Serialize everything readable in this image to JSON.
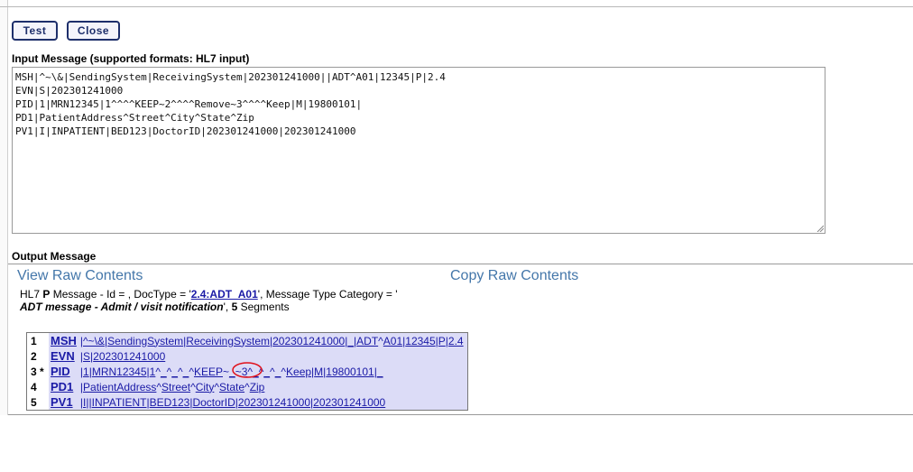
{
  "toolbar": {
    "test_label": "Test",
    "close_label": "Close"
  },
  "input": {
    "label": "Input Message (supported formats: HL7 input)",
    "lines": [
      "MSH|^~\\&|SendingSystem|ReceivingSystem|202301241000||ADT^A01|12345|P|2.4",
      "EVN|S|202301241000",
      "PID|1|MRN12345|1^^^^KEEP~2^^^^Remove~3^^^^Keep|M|19800101|",
      "PD1|PatientAddress^Street^City^State^Zip",
      "PV1|I|INPATIENT|BED123|DoctorID|202301241000|202301241000"
    ]
  },
  "output": {
    "label": "Output Message",
    "view_raw": "View Raw Contents",
    "copy_raw": "Copy Raw Contents",
    "summary": {
      "prefix": "HL7 ",
      "p": "P",
      "mid": " Message - Id = , DocType = '",
      "doctype": "2.4:ADT_A01",
      "after_doctype": "', Message Type Category = '",
      "category": "ADT message - Admit / visit notification",
      "after_category": "', ",
      "segment_count": "5",
      "tail": " Segments"
    },
    "segments": [
      {
        "num": "1",
        "name": "MSH",
        "fields": [
          "|",
          "^~\\&",
          "|",
          "SendingSystem",
          "|",
          "ReceivingSystem",
          "|",
          "202301241000",
          "|",
          "_",
          "|",
          "ADT",
          "^",
          "A01",
          "|",
          "12345",
          "|",
          "P",
          "|",
          "2.4"
        ]
      },
      {
        "num": "2",
        "name": "EVN",
        "fields": [
          "|",
          "S",
          "|",
          "202301241000"
        ]
      },
      {
        "num": "3 *",
        "name": "PID",
        "fields": [
          "|",
          "1",
          "|",
          "MRN12345",
          "|",
          "1",
          "^",
          "_",
          "^",
          "_",
          "^",
          "_",
          "^",
          "KEEP",
          "~",
          "_",
          "~",
          "3",
          "^",
          "_",
          "^",
          "_",
          "^",
          "_",
          "^",
          "Keep",
          "|",
          "M",
          "|",
          "19800101",
          "|",
          "_"
        ]
      },
      {
        "num": "4",
        "name": "PD1",
        "fields": [
          "|",
          "PatientAddress",
          "^",
          "Street",
          "^",
          "City",
          "^",
          "State",
          "^",
          "Zip"
        ]
      },
      {
        "num": "5",
        "name": "PV1",
        "fields": [
          "|",
          "I",
          "|",
          "|",
          "INPATIENT",
          "|",
          "BED123",
          "|",
          "DoctorID",
          "|",
          "202301241000",
          "|",
          "202301241000"
        ]
      }
    ]
  },
  "colors": {
    "link": "#1a1aa6",
    "raw_link": "#4477aa",
    "segment_bg": "#dcdcf7",
    "annotation": "#e0101a",
    "button_border": "#1e2f6b"
  },
  "icons": {
    "resize": "resize-grip-icon",
    "annotation": "red-circle-annotation"
  }
}
